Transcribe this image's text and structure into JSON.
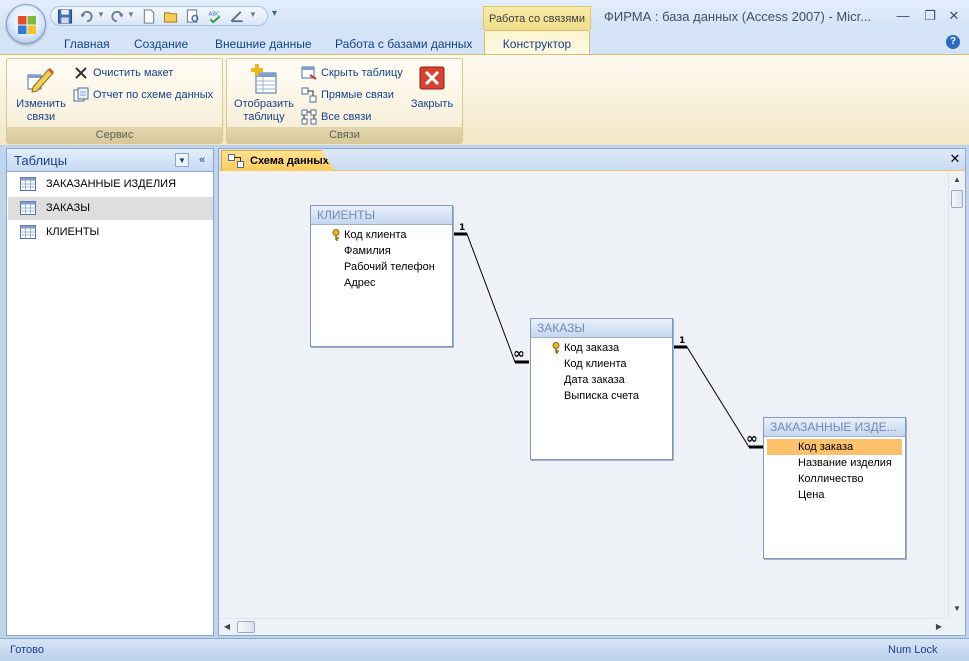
{
  "window": {
    "title": "ФИРМА : база данных (Access 2007) - Micr...",
    "contextual_tab_group": "Работа со связями"
  },
  "ribbon_tabs": [
    "Главная",
    "Создание",
    "Внешние данные",
    "Работа с базами данных",
    "Конструктор"
  ],
  "ribbon": {
    "groups": {
      "service": {
        "label": "Сервис",
        "edit_relationships": "Изменить\nсвязи",
        "clear_layout": "Очистить макет",
        "relationship_report": "Отчет по схеме данных"
      },
      "relationships": {
        "label": "Связи",
        "show_table": "Отобразить\nтаблицу",
        "hide_table": "Скрыть таблицу",
        "direct_relationships": "Прямые связи",
        "all_relationships": "Все связи",
        "close": "Закрыть"
      }
    }
  },
  "nav_pane": {
    "title": "Таблицы",
    "items": [
      {
        "label": "ЗАКАЗАННЫЕ ИЗДЕЛИЯ",
        "selected": false
      },
      {
        "label": "ЗАКАЗЫ",
        "selected": true
      },
      {
        "label": "КЛИЕНТЫ",
        "selected": false
      }
    ]
  },
  "document": {
    "tab_label": "Схема данных",
    "tables": [
      {
        "name": "КЛИЕНТЫ",
        "fields": [
          {
            "name": "Код клиента",
            "key": true
          },
          {
            "name": "Фамилия",
            "key": false
          },
          {
            "name": "Рабочий телефон",
            "key": false
          },
          {
            "name": "Адрес",
            "key": false
          }
        ]
      },
      {
        "name": "ЗАКАЗЫ",
        "fields": [
          {
            "name": "Код заказа",
            "key": true
          },
          {
            "name": "Код клиента",
            "key": false
          },
          {
            "name": "Дата заказа",
            "key": false
          },
          {
            "name": "Выписка счета",
            "key": false
          }
        ]
      },
      {
        "name": "ЗАКАЗАННЫЕ ИЗДЕ...",
        "fields": [
          {
            "name": "Код заказа",
            "key": false,
            "highlighted": true
          },
          {
            "name": "Название изделия",
            "key": false
          },
          {
            "name": "Колличество",
            "key": false
          },
          {
            "name": "Цена",
            "key": false
          }
        ]
      }
    ],
    "relationships": [
      {
        "from_table": "КЛИЕНТЫ",
        "to_table": "ЗАКАЗЫ",
        "one_label": "1",
        "many_label": "∞"
      },
      {
        "from_table": "ЗАКАЗЫ",
        "to_table": "ЗАКАЗАННЫЕ ИЗДЕЛИЯ",
        "one_label": "1",
        "many_label": "∞"
      }
    ]
  },
  "status_bar": {
    "left": "Готово",
    "right": "Num Lock"
  },
  "colors": {
    "accent": "#15428b",
    "highlight_field": "#fcc26b",
    "contextual_tab": "#f3df8b"
  }
}
